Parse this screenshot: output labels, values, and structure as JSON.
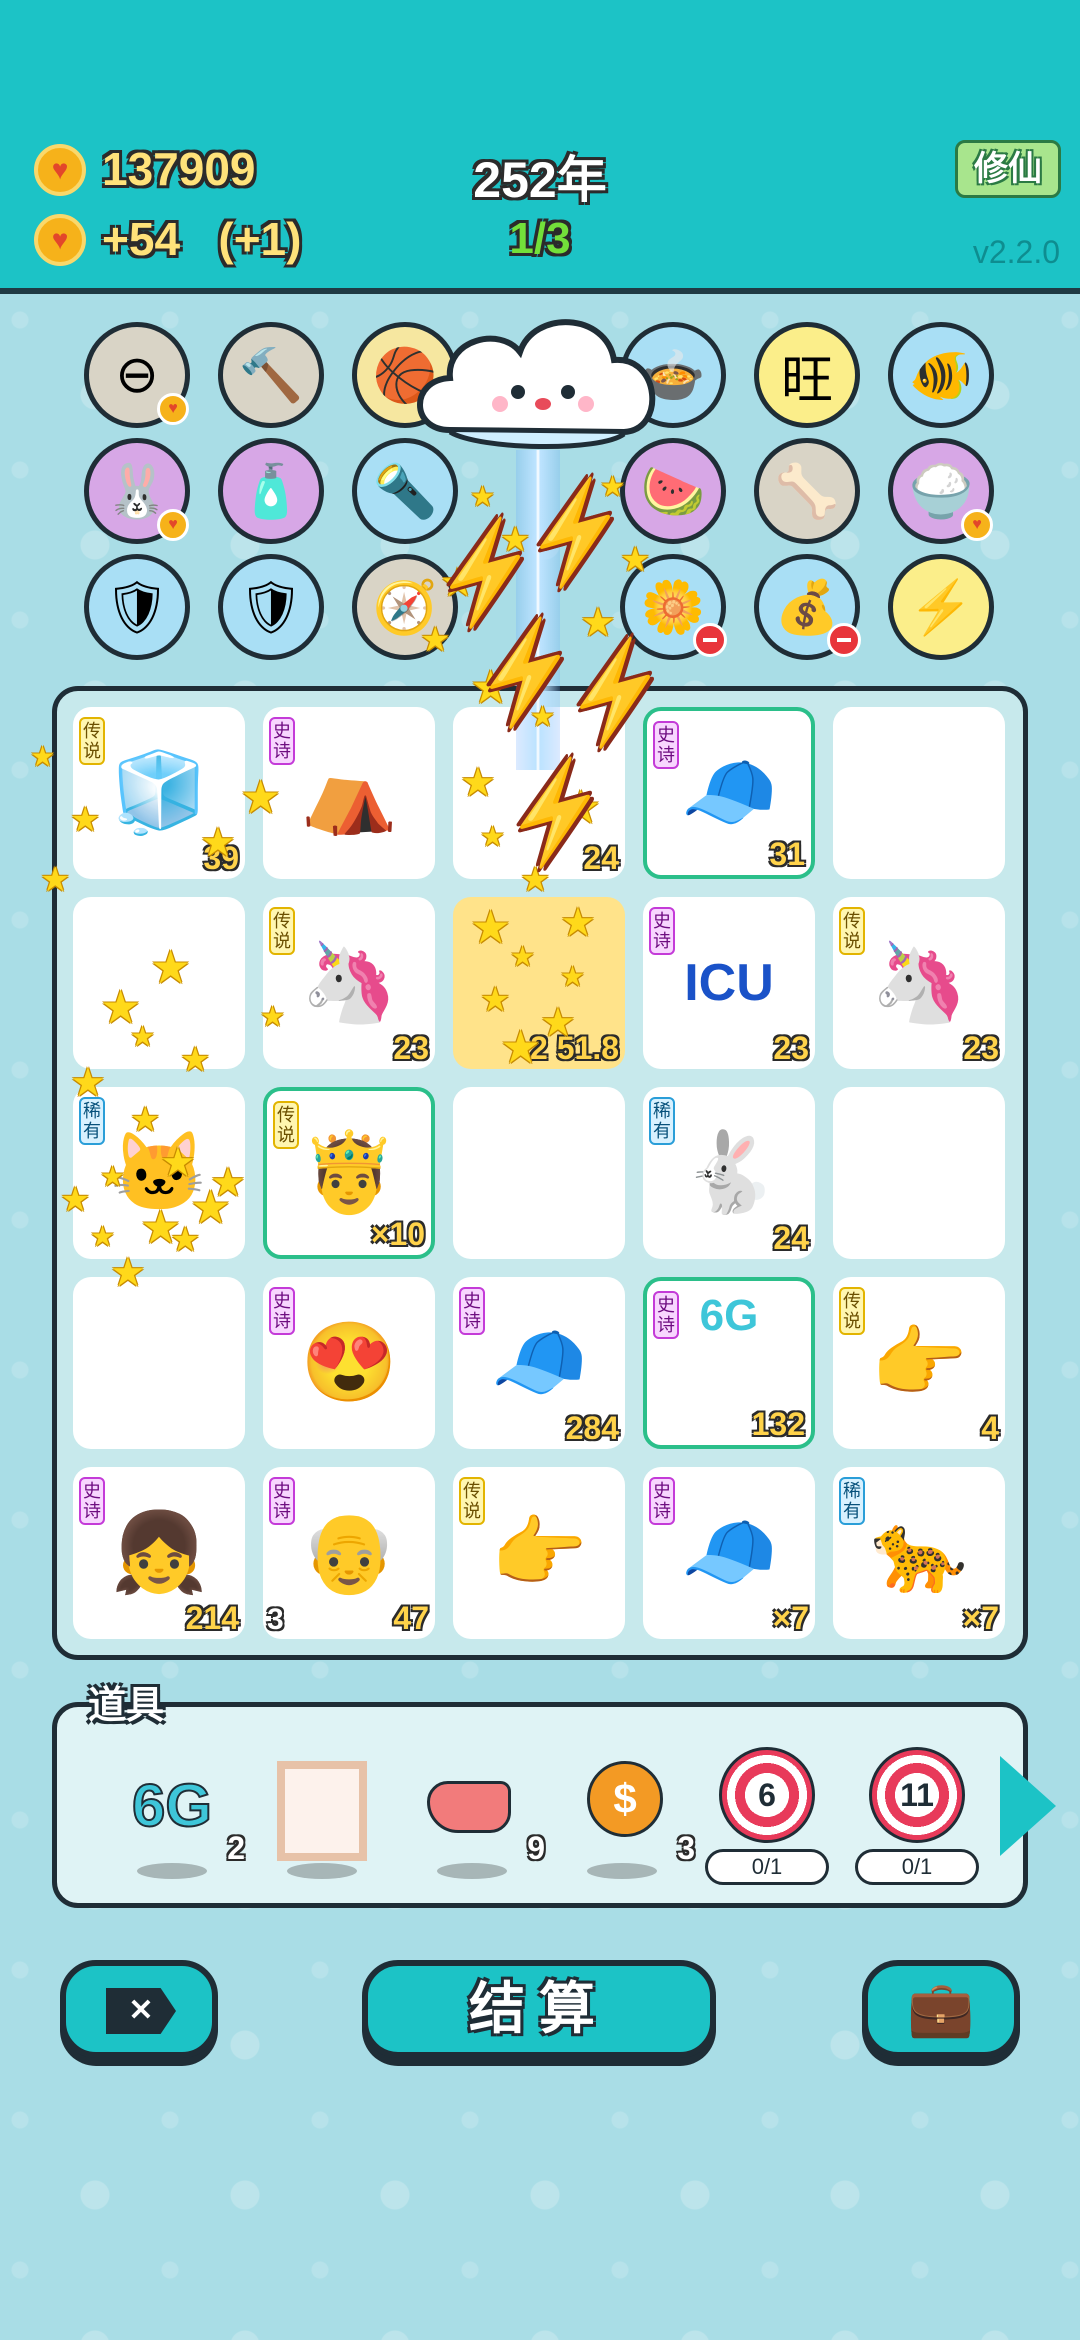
{
  "header": {
    "coins": "137909",
    "income": "+54",
    "income_bonus": "(+1)",
    "year": "252年",
    "round": "1/3",
    "cultivate_label": "修仙",
    "version": "v2.2.0"
  },
  "orbs": [
    {
      "name": "minus-icon",
      "color": "#d9d4c6",
      "glyph": "⊖",
      "badge": "heart"
    },
    {
      "name": "hammer-icon",
      "color": "#d9d4c6",
      "glyph": "🔨",
      "badge": ""
    },
    {
      "name": "basketball-icon",
      "color": "#f6e7a0",
      "glyph": "🏀",
      "badge": ""
    },
    {
      "name": "pot-duck-icon",
      "color": "#a9dff5",
      "glyph": "🍲",
      "badge": ""
    },
    {
      "name": "wang-icon",
      "color": "#fbee8a",
      "glyph": "旺",
      "badge": ""
    },
    {
      "name": "fishbowl-icon",
      "color": "#a9dff5",
      "glyph": "🐠",
      "badge": ""
    },
    {
      "name": "rabbit-icon",
      "color": "#d7a7e6",
      "glyph": "🐰",
      "badge": "heart"
    },
    {
      "name": "pump-bottle-icon",
      "color": "#d7a7e6",
      "glyph": "🧴",
      "badge": ""
    },
    {
      "name": "lamp-icon",
      "color": "#a9dff5",
      "glyph": "🔦",
      "badge": ""
    },
    {
      "name": "watermelon-icon",
      "color": "#d7a7e6",
      "glyph": "🍉",
      "badge": ""
    },
    {
      "name": "dog-bowl-icon",
      "color": "#d9d4c6",
      "glyph": "🦴",
      "badge": ""
    },
    {
      "name": "rice-bowl-icon",
      "color": "#d7a7e6",
      "glyph": "🍚",
      "badge": "heart"
    },
    {
      "name": "shield-wrench-icon",
      "color": "#a9dff5",
      "glyph": "🛡",
      "badge": ""
    },
    {
      "name": "shield-wrench-icon",
      "color": "#a9dff5",
      "glyph": "🛡",
      "badge": ""
    },
    {
      "name": "compass-icon",
      "color": "#d9d4c6",
      "glyph": "🧭",
      "badge": ""
    },
    {
      "name": "flower-pot-icon",
      "color": "#a9dff5",
      "glyph": "🌼",
      "badge": "minus"
    },
    {
      "name": "sack-icon",
      "color": "#a9dff5",
      "glyph": "💰",
      "badge": "minus"
    },
    {
      "name": "lightning-icon",
      "color": "#fbee8a",
      "glyph": "⚡",
      "badge": ""
    }
  ],
  "tag_labels": {
    "legend": "传说",
    "epic": "史诗",
    "rare": "稀有"
  },
  "board": [
    {
      "name": "fridge-card",
      "tag": "legend",
      "glyph": "🧊",
      "count": "39",
      "hl": false
    },
    {
      "name": "rabbit-tent-card",
      "tag": "epic",
      "glyph": "⛺",
      "count": "",
      "hl": false
    },
    {
      "name": "empty-card",
      "tag": "",
      "glyph": "",
      "count": "24",
      "hl": false
    },
    {
      "name": "green-cap-man-card",
      "tag": "epic",
      "glyph": "🧢",
      "count": "31",
      "hl": true
    },
    {
      "name": "empty-card",
      "tag": "",
      "glyph": "",
      "count": "",
      "hl": false
    },
    {
      "name": "empty-card",
      "tag": "",
      "glyph": "",
      "count": "",
      "hl": false
    },
    {
      "name": "unicorn-card",
      "tag": "legend",
      "glyph": "🦄",
      "count": "23",
      "hl": false
    },
    {
      "name": "golden-card",
      "tag": "",
      "glyph": "",
      "count": "2 51.8",
      "hl": false
    },
    {
      "name": "icu-card",
      "tag": "epic",
      "glyph": "ICU",
      "count": "23",
      "hl": false
    },
    {
      "name": "unicorn-card",
      "tag": "legend",
      "glyph": "🦄",
      "count": "23",
      "hl": false
    },
    {
      "name": "cat-card",
      "tag": "rare",
      "glyph": "🐱",
      "count": "",
      "hl": false
    },
    {
      "name": "king-card",
      "tag": "legend",
      "glyph": "🤴",
      "count": "×10",
      "hl": true
    },
    {
      "name": "empty-card",
      "tag": "",
      "glyph": "",
      "count": "",
      "hl": false
    },
    {
      "name": "rabbit-card",
      "tag": "rare",
      "glyph": "🐇",
      "count": "24",
      "hl": false
    },
    {
      "name": "empty-card",
      "tag": "",
      "glyph": "",
      "count": "",
      "hl": false
    },
    {
      "name": "empty-card",
      "tag": "",
      "glyph": "",
      "count": "",
      "hl": false
    },
    {
      "name": "love-face-card",
      "tag": "epic",
      "glyph": "😍",
      "count": "",
      "hl": false
    },
    {
      "name": "green-cap-man-card",
      "tag": "epic",
      "glyph": "🧢",
      "count": "284",
      "hl": false
    },
    {
      "name": "6g-tower-card",
      "tag": "epic",
      "glyph": "6G",
      "count": "132",
      "hl": true
    },
    {
      "name": "pointing-hand-card",
      "tag": "legend",
      "glyph": "👉",
      "count": "4",
      "hl": false
    },
    {
      "name": "girl-card",
      "tag": "epic",
      "glyph": "👧",
      "count": "214",
      "hl": false
    },
    {
      "name": "grandpa-card",
      "tag": "epic",
      "glyph": "👴",
      "count": "47",
      "sub": "3",
      "hl": false
    },
    {
      "name": "pointing-hand-card",
      "tag": "legend",
      "glyph": "👉",
      "count": "",
      "hl": false
    },
    {
      "name": "green-cap-man-card",
      "tag": "epic",
      "glyph": "🧢",
      "count": "×7",
      "hl": false
    },
    {
      "name": "leopard-card",
      "tag": "rare",
      "glyph": "🐆",
      "count": "×7",
      "hl": false
    }
  ],
  "props": {
    "title": "道具",
    "items": [
      {
        "name": "6g-prop",
        "label": "6G",
        "qty": "2"
      },
      {
        "name": "frame-prop",
        "label": "",
        "qty": ""
      },
      {
        "name": "liver-prop",
        "label": "",
        "qty": "9"
      },
      {
        "name": "coin-prop",
        "label": "$",
        "qty": "3"
      },
      {
        "name": "target-6-prop",
        "label": "6",
        "progress": "0/1"
      },
      {
        "name": "target-11-prop",
        "label": "11",
        "progress": "0/1"
      }
    ]
  },
  "buttons": {
    "close": "✕",
    "settle": "结算",
    "bag": "💼"
  }
}
